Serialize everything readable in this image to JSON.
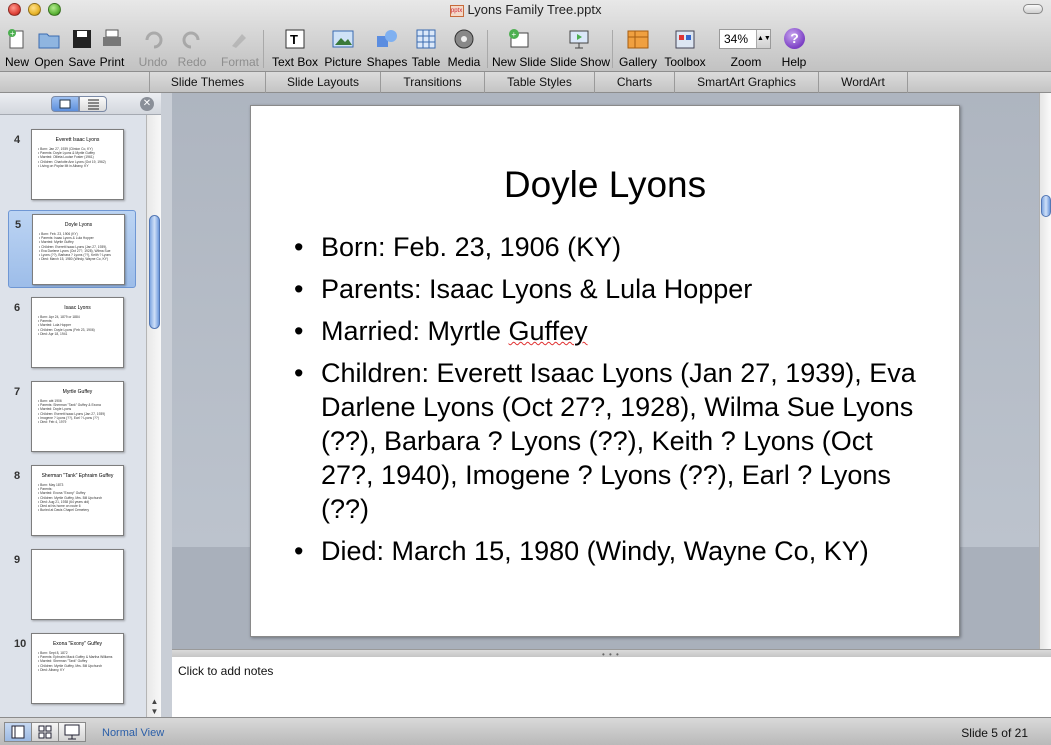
{
  "window": {
    "title": "Lyons Family Tree.pptx"
  },
  "toolbar": {
    "new": "New",
    "open": "Open",
    "save": "Save",
    "print": "Print",
    "undo": "Undo",
    "redo": "Redo",
    "format": "Format",
    "text_box": "Text Box",
    "picture": "Picture",
    "shapes": "Shapes",
    "table": "Table",
    "media": "Media",
    "new_slide": "New Slide",
    "slide_show": "Slide Show",
    "gallery": "Gallery",
    "toolbox": "Toolbox",
    "zoom_value": "34%",
    "zoom_label": "Zoom",
    "help": "Help"
  },
  "tabs": [
    "Slide Themes",
    "Slide Layouts",
    "Transitions",
    "Table Styles",
    "Charts",
    "SmartArt Graphics",
    "WordArt"
  ],
  "thumbnails": [
    {
      "num": "4",
      "title": "Everett Isaac Lyons",
      "lines": [
        "Born: Jan 27, 1939 (Clinton Co, KY)",
        "Parents: Doyle Lyons & Myrtle Guffey",
        "Married: Ollieta Louise Foster (1961)",
        "Children: Charlotte Ann Lyons (Oct 19, 1962)",
        "Living on Poplar Mt in Albany, KY"
      ]
    },
    {
      "num": "5",
      "title": "Doyle Lyons",
      "lines": [
        "Born: Feb. 23, 1906 (KY)",
        "Parents: Isaac Lyons & Lula Hopper",
        "Married: Myrtle Guffey",
        "Children: Everett Isaac Lyons (Jan 27, 1939),",
        "Eva Darlene Lyons (Oct 27?, 1928), Wilma Sue",
        "Lyons (??), Barbara ? Lyons (??), Keith ? Lyons",
        "Died: March 15, 1980 (Windy, Wayne Co, KY)"
      ]
    },
    {
      "num": "6",
      "title": "Isaac Lyons",
      "lines": [
        "Born: Apr 24, 1879 or 1884",
        "Parents:",
        "Married: Lula Hopper",
        "Children: Doyle Lyons (Feb 23, 1906)",
        "Died: Apr 18, 1941"
      ]
    },
    {
      "num": "7",
      "title": "Myrtle Guffey",
      "lines": [
        "Born: abt 1906",
        "Parents: Sherman \"Tank\" Guffey & Exona",
        "Married: Doyle Lyons",
        "Children: Everett Isaac Lyons (Jan 27, 1939)",
        "Imogene ? Lyons (??), Earl ? Lyons (??)",
        "Died: Feb 4, 1979"
      ]
    },
    {
      "num": "8",
      "title": "Sherman \"Tank\" Ephraim Guffey",
      "lines": [
        "Born: May 1873",
        "Parents:",
        "Married: Exona \"Exony\" Guffey",
        "Children: Myrtle Guffey, Mrs. Bill Upchurch",
        "Died: Aug 21, 1938 (64 years old)",
        "Died at his home on route 6",
        "Buried at Davis Chapel Cemetery"
      ]
    },
    {
      "num": "9",
      "title": "",
      "lines": []
    },
    {
      "num": "10",
      "title": "Exona \"Exony\" Guffey",
      "lines": [
        "Born: Sept 8, 1872",
        "Parents: Ephraim Mack Guffey & Martha Williams",
        "Married: Sherman \"Tank\" Guffey",
        "Children: Myrtle Guffey, Mrs. Bill Upchurch",
        "Died: Albany, KY"
      ]
    }
  ],
  "slide": {
    "title": "Doyle Lyons",
    "bullets": [
      {
        "pre": "Born: Feb. 23, 1906 (KY)",
        "squiggle": "",
        "post": ""
      },
      {
        "pre": "Parents:  Isaac Lyons & Lula Hopper",
        "squiggle": "",
        "post": ""
      },
      {
        "pre": "Married:  Myrtle ",
        "squiggle": "Guffey",
        "post": ""
      },
      {
        "pre": "Children:  Everett Isaac Lyons (Jan 27, 1939), Eva Darlene Lyons (Oct 27?, 1928), Wilma Sue Lyons (??), Barbara ? Lyons (??), Keith ? Lyons (Oct 27?, 1940), Imogene ? Lyons (??), Earl ? Lyons (??)",
        "squiggle": "",
        "post": ""
      },
      {
        "pre": "Died:  March 15, 1980 (Windy, Wayne Co, KY)",
        "squiggle": "",
        "post": ""
      }
    ]
  },
  "notes": {
    "placeholder": "Click to add notes"
  },
  "status": {
    "view": "Normal View",
    "slide_position": "Slide 5 of 21"
  }
}
